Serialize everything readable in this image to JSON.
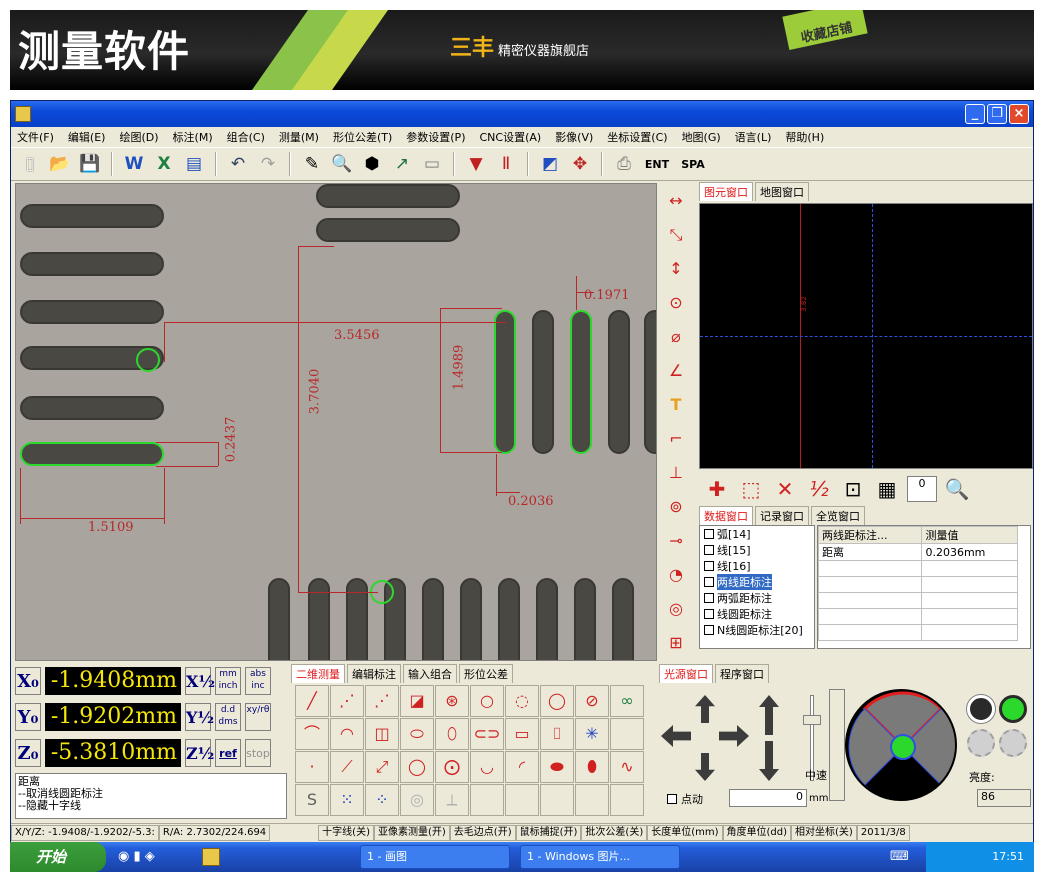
{
  "banner": {
    "title": "测量软件",
    "brand_mark": "三丰",
    "shop": "精密仪器旗舰店",
    "corner": "收藏店铺"
  },
  "menu": [
    "文件(F)",
    "编辑(E)",
    "绘图(D)",
    "标注(M)",
    "组合(C)",
    "测量(M)",
    "形位公差(T)",
    "参数设置(P)",
    "CNC设置(A)",
    "影像(V)",
    "坐标设置(C)",
    "地图(G)",
    "语言(L)",
    "帮助(H)"
  ],
  "toolbar": {
    "ent": "ENT",
    "spa": "SPA"
  },
  "camera": {
    "labels": {
      "d1": "0.1971",
      "d2": "3.5456",
      "d3": "1.4989",
      "d4": "3.7040",
      "d5": "0.2437",
      "d6": "0.2036",
      "d7": "1.5109"
    }
  },
  "right_tabs": {
    "figure": "图元窗口",
    "map": "地图窗口"
  },
  "map_overlay": "3.82",
  "counter": "0",
  "data_tabs": {
    "data": "数据窗口",
    "record": "记录窗口",
    "overview": "全览窗口"
  },
  "element_list": [
    "弧[14]",
    "线[15]",
    "线[16]",
    "两线距标注",
    "两弧距标注",
    "线圆距标注",
    "N线圆距标注[20]"
  ],
  "data_table": {
    "headers": [
      "两线距标注...",
      "测量值"
    ],
    "rows": [
      [
        "距离",
        "0.2036mm"
      ]
    ]
  },
  "coords": {
    "x_label": "X₀",
    "x_value": "-1.9408mm",
    "y_label": "Y₀",
    "y_value": "-1.9202mm",
    "z_label": "Z₀",
    "z_value": "-5.3810mm",
    "x_btns": [
      "X½",
      "mm inch",
      "abs inc"
    ],
    "y_btns": [
      "Y½",
      "d.d dms",
      "xy/rθ"
    ],
    "z_btns": [
      "Z½",
      "ref",
      "stop"
    ]
  },
  "log": [
    "距离",
    "--取消线圆距标注",
    "--隐藏十字线"
  ],
  "measure_tabs": [
    "二维测量",
    "编辑标注",
    "输入组合",
    "形位公差"
  ],
  "light_tabs": {
    "light": "光源窗口",
    "program": "程序窗口"
  },
  "light": {
    "mode": "中速",
    "point": "点动",
    "step": "0",
    "step_unit": "mm",
    "brightness_label": "亮度:",
    "brightness": "86"
  },
  "status": [
    "X/Y/Z: -1.9408/-1.9202/-5.3:",
    "R/A: 2.7302/224.694",
    "十字线(关)",
    "亚像素测量(开)",
    "去毛边点(开)",
    "鼠标捕捉(开)",
    "批次公差(关)",
    "长度单位(mm)",
    "角度单位(dd)",
    "相对坐标(关)",
    "2011/3/8"
  ],
  "taskbar": {
    "start": "开始",
    "task1": "1 - 画图",
    "task2": "1 - Windows 图片...",
    "time": "17:51"
  }
}
